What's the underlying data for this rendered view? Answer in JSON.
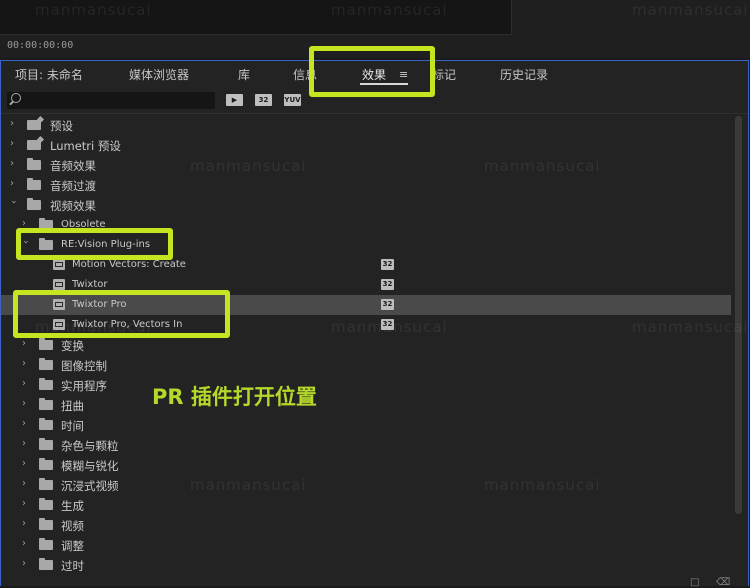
{
  "timecode": "00:00:00:00",
  "tabs": [
    {
      "label": "项目: 未命名"
    },
    {
      "label": "媒体浏览器"
    },
    {
      "label": "库"
    },
    {
      "label": "信息"
    },
    {
      "label": "效果"
    },
    {
      "label": "标记"
    },
    {
      "label": "历史记录"
    }
  ],
  "search": {
    "placeholder": ""
  },
  "filter_buttons": [
    "▶",
    "32",
    "YUV"
  ],
  "tree": [
    {
      "label": "预设",
      "icon": "preset-folder-icon",
      "expanded": false
    },
    {
      "label": "Lumetri 预设",
      "icon": "preset-folder-icon",
      "expanded": false
    },
    {
      "label": "音频效果",
      "icon": "folder-icon",
      "expanded": false
    },
    {
      "label": "音频过渡",
      "icon": "folder-icon",
      "expanded": false
    },
    {
      "label": "视频效果",
      "icon": "folder-icon",
      "expanded": true
    },
    {
      "label": "Obsolete",
      "icon": "folder-icon",
      "expanded": false
    },
    {
      "label": "RE:Vision Plug-ins",
      "icon": "folder-icon",
      "expanded": true
    },
    {
      "label": "Motion Vectors: Create",
      "icon": "effect-icon",
      "badge": "32"
    },
    {
      "label": "Twixtor",
      "icon": "effect-icon",
      "badge": "32"
    },
    {
      "label": "Twixtor Pro",
      "icon": "effect-icon",
      "badge": "32",
      "selected": true
    },
    {
      "label": "Twixtor Pro, Vectors In",
      "icon": "effect-icon",
      "badge": "32"
    },
    {
      "label": "变换",
      "icon": "folder-icon",
      "expanded": false
    },
    {
      "label": "图像控制",
      "icon": "folder-icon",
      "expanded": false
    },
    {
      "label": "实用程序",
      "icon": "folder-icon",
      "expanded": false
    },
    {
      "label": "扭曲",
      "icon": "folder-icon",
      "expanded": false
    },
    {
      "label": "时间",
      "icon": "folder-icon",
      "expanded": false
    },
    {
      "label": "杂色与颗粒",
      "icon": "folder-icon",
      "expanded": false
    },
    {
      "label": "模糊与锐化",
      "icon": "folder-icon",
      "expanded": false
    },
    {
      "label": "沉浸式视频",
      "icon": "folder-icon",
      "expanded": false
    },
    {
      "label": "生成",
      "icon": "folder-icon",
      "expanded": false
    },
    {
      "label": "视频",
      "icon": "folder-icon",
      "expanded": false
    },
    {
      "label": "调整",
      "icon": "folder-icon",
      "expanded": false
    },
    {
      "label": "过时",
      "icon": "folder-icon",
      "expanded": false
    }
  ],
  "annotation": "PR 插件打开位置",
  "watermark": "manmansucai",
  "colors": {
    "highlight": "#c4e51f",
    "accent_border": "#3b62c8",
    "selected_row": "#4a4a4a"
  }
}
